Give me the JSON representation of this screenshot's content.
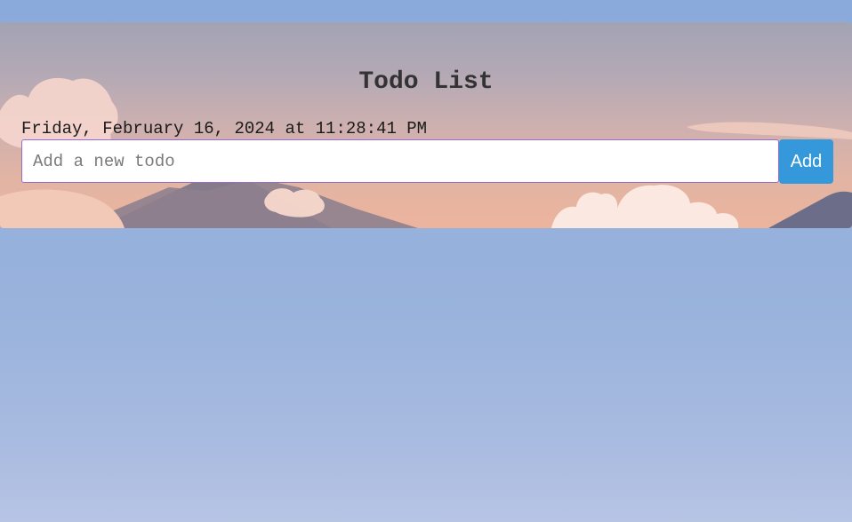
{
  "app": {
    "title": "Todo List",
    "datetime": "Friday, February 16, 2024 at 11:28:41 PM"
  },
  "form": {
    "input_value": "",
    "input_placeholder": "Add a new todo",
    "add_label": "Add"
  },
  "colors": {
    "accent_button": "#3498db",
    "input_border": "#9a6ad0",
    "title_text": "#333333"
  },
  "icons": {
    "background": "mountain-sunset-illustration"
  }
}
